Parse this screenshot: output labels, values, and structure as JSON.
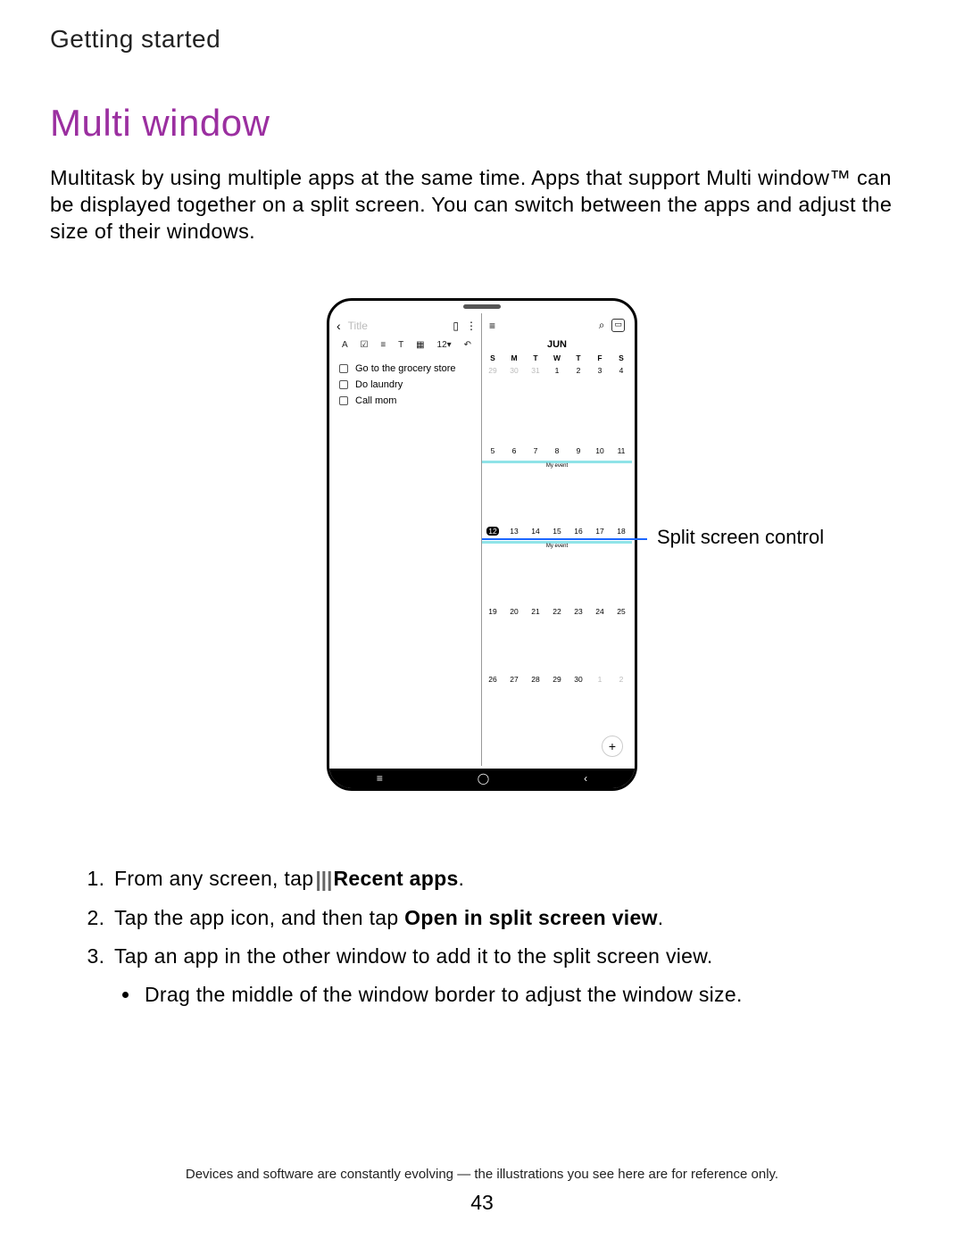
{
  "breadcrumb": "Getting started",
  "title": "Multi window",
  "intro": "Multitask by using multiple apps at the same time. Apps that support Multi window™ can be displayed together on a split screen. You can switch between the apps and adjust the size of their windows.",
  "callout": "Split screen control",
  "phone": {
    "notes": {
      "title_placeholder": "Title",
      "items": [
        "Go to the grocery store",
        "Do laundry",
        "Call mom"
      ],
      "toolbar_font_size": "12"
    },
    "calendar": {
      "month": "JUN",
      "weekday": [
        "S",
        "M",
        "T",
        "W",
        "T",
        "F",
        "S"
      ],
      "weeks": [
        {
          "dates": [
            "29",
            "30",
            "31",
            "1",
            "2",
            "3",
            "4"
          ],
          "muted": [
            0,
            1,
            2
          ],
          "event": null,
          "today": null
        },
        {
          "dates": [
            "5",
            "6",
            "7",
            "8",
            "9",
            "10",
            "11"
          ],
          "muted": [],
          "event": "My event",
          "today": null
        },
        {
          "dates": [
            "12",
            "13",
            "14",
            "15",
            "16",
            "17",
            "18"
          ],
          "muted": [],
          "event": "My event",
          "today": 0
        },
        {
          "dates": [
            "19",
            "20",
            "21",
            "22",
            "23",
            "24",
            "25"
          ],
          "muted": [],
          "event": null,
          "today": null
        },
        {
          "dates": [
            "26",
            "27",
            "28",
            "29",
            "30",
            "1",
            "2"
          ],
          "muted": [
            5,
            6
          ],
          "event": null,
          "today": null
        }
      ],
      "event_label": "My event"
    }
  },
  "steps": {
    "s1_pre": "From any screen, tap",
    "s1_bold": "Recent apps",
    "s1_post": ".",
    "s2_pre": "Tap the app icon, and then tap ",
    "s2_bold": "Open in split screen view",
    "s2_post": ".",
    "s3": "Tap an app in the other window to add it to the split screen view.",
    "s3_sub": "Drag the middle of the window border to adjust the window size."
  },
  "footnote": "Devices and software are constantly evolving — the illustrations you see here are for reference only.",
  "page_number": "43"
}
